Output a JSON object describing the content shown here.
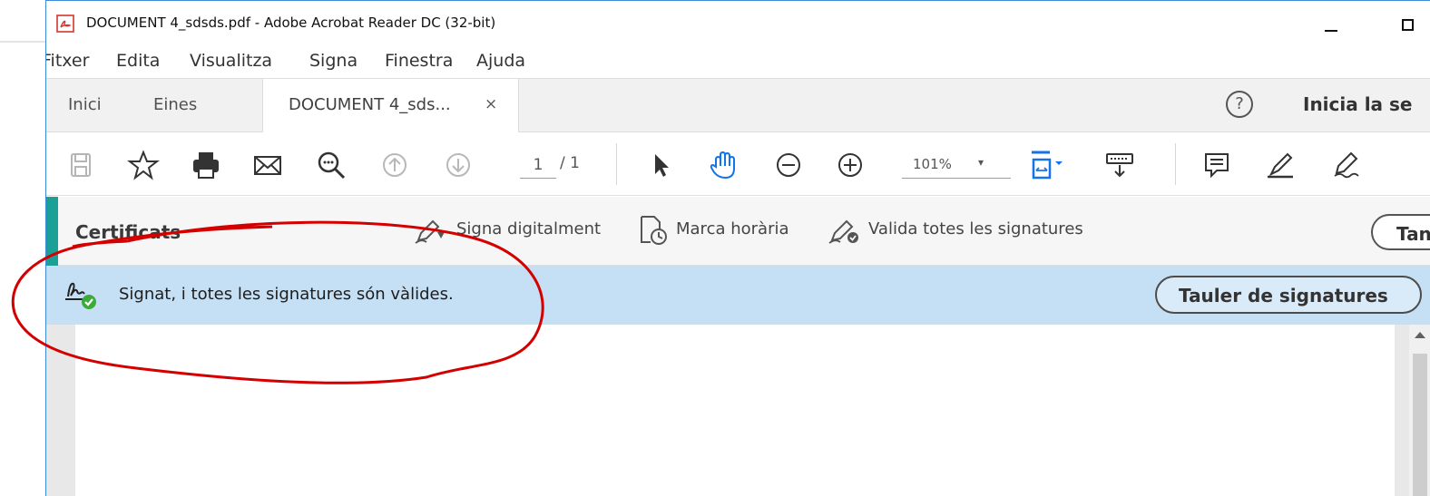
{
  "window": {
    "title": "DOCUMENT 4_sdsds.pdf - Adobe Acrobat Reader DC (32-bit)"
  },
  "menu": {
    "items": [
      "Fitxer",
      "Edita",
      "Visualitza",
      "Signa",
      "Finestra",
      "Ajuda"
    ]
  },
  "tabs": {
    "home": "Inici",
    "tools": "Eines",
    "document": "DOCUMENT 4_sds...",
    "close_glyph": "×",
    "help_glyph": "?",
    "signin": "Inicia la se"
  },
  "toolbar": {
    "page_current": "1",
    "page_total": "/ 1",
    "zoom": "101%",
    "zoom_caret": "▾",
    "icons": [
      "save-icon",
      "star-icon",
      "print-icon",
      "email-icon",
      "search-icon",
      "page-up-icon",
      "page-down-icon",
      "select-arrow-icon",
      "hand-icon",
      "zoom-out-icon",
      "zoom-in-icon",
      "fit-page-icon",
      "scroll-mode-icon",
      "comment-icon",
      "highlight-icon",
      "sign-icon"
    ]
  },
  "certificates": {
    "title": "Certificats",
    "actions": {
      "sign_digitally": "Signa digitalment",
      "timestamp": "Marca horària",
      "validate_all": "Valida totes les signatures"
    },
    "close_label": "Tan"
  },
  "signature_status": {
    "message": "Signat, i totes les signatures són vàlides.",
    "panel_button": "Tauler de signatures"
  },
  "colors": {
    "accent": "#1aa096",
    "status_bar": "#c5dff4",
    "valid_check": "#3dab3a",
    "annotation": "#d40000"
  }
}
